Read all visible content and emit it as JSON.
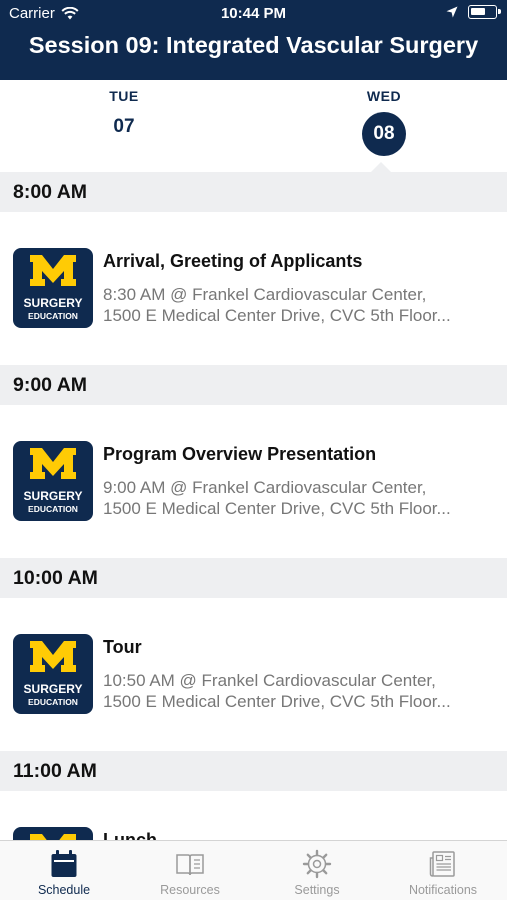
{
  "status_bar": {
    "carrier": "Carrier",
    "time": "10:44 PM"
  },
  "header": {
    "title": "Session 09: Integrated Vascular Surgery"
  },
  "days": [
    {
      "dow": "TUE",
      "num": "07",
      "selected": false
    },
    {
      "dow": "WED",
      "num": "08",
      "selected": true
    }
  ],
  "logo": {
    "letter": "M",
    "line1": "SURGERY",
    "line2": "EDUCATION"
  },
  "schedule": [
    {
      "time": "8:00 AM",
      "event": {
        "title": "Arrival, Greeting of Applicants",
        "line1": "8:30 AM @ Frankel Cardiovascular Center,",
        "line2": "1500 E Medical Center Drive, CVC 5th Floor..."
      }
    },
    {
      "time": "9:00 AM",
      "event": {
        "title": "Program Overview Presentation",
        "line1": "9:00 AM @ Frankel Cardiovascular Center,",
        "line2": "1500 E Medical Center Drive, CVC 5th Floor..."
      }
    },
    {
      "time": "10:00 AM",
      "event": {
        "title": "Tour",
        "line1": "10:50 AM @ Frankel Cardiovascular Center,",
        "line2": "1500 E Medical Center Drive, CVC 5th Floor..."
      }
    },
    {
      "time": "11:00 AM",
      "event": {
        "title": "Lunch",
        "line1": "",
        "line2": ""
      }
    }
  ],
  "tabs": [
    {
      "label": "Schedule",
      "icon": "calendar-icon",
      "active": true
    },
    {
      "label": "Resources",
      "icon": "book-icon",
      "active": false
    },
    {
      "label": "Settings",
      "icon": "gear-icon",
      "active": false
    },
    {
      "label": "Notifications",
      "icon": "newspaper-icon",
      "active": false
    }
  ],
  "colors": {
    "brand_navy": "#0f2a4f",
    "brand_maize": "#ffcb05",
    "section_bg": "#eeeff1"
  }
}
